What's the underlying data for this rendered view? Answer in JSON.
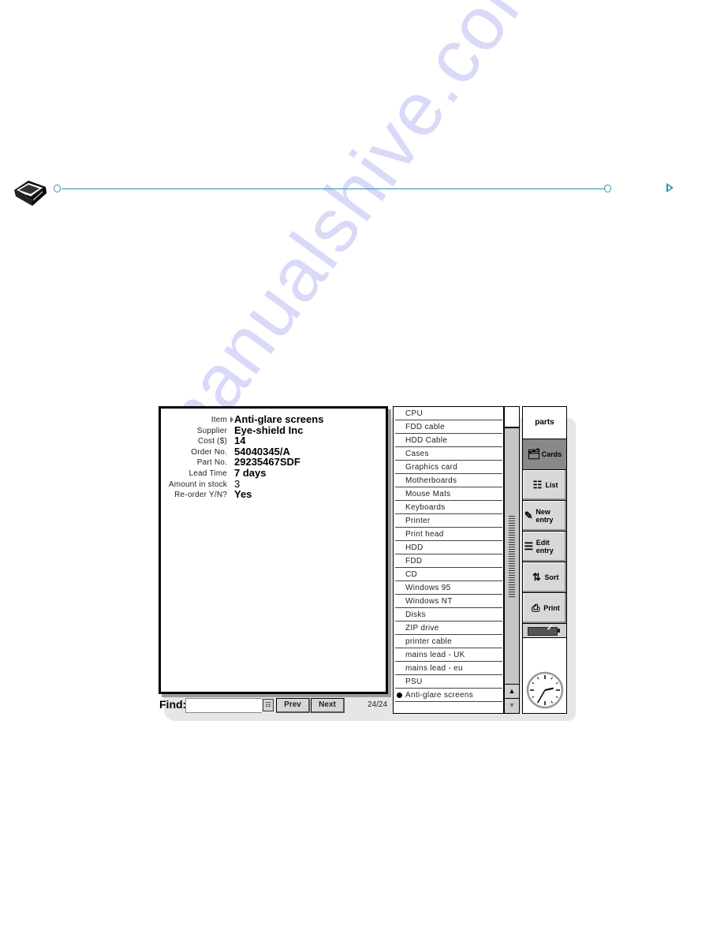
{
  "header": {
    "logo_icon": "psion-organiser-book-icon",
    "next_page_icon": "triangle-right-icon",
    "accent_color": "#2f8fb5"
  },
  "card": {
    "fields": [
      {
        "label": "Item",
        "value": "Anti-glare screens",
        "current": true
      },
      {
        "label": "Supplier",
        "value": "Eye-shield Inc"
      },
      {
        "label": "Cost ($)",
        "value": "14"
      },
      {
        "label": "Order No.",
        "value": "54040345/A"
      },
      {
        "label": "Part No.",
        "value": "29235467SDF"
      },
      {
        "label": "Lead Time",
        "value": "7 days"
      },
      {
        "label": "Amount in stock",
        "value": "3"
      },
      {
        "label": "Re-order Y/N?",
        "value": "Yes"
      }
    ]
  },
  "find_bar": {
    "label": "Find:",
    "input_value": "",
    "list_button_icon": "list-icon",
    "prev_label": "Prev",
    "next_label": "Next",
    "record_count": "24/24"
  },
  "list": {
    "items": [
      "CPU",
      "FDD cable",
      "HDD Cable",
      "Cases",
      "Graphics card",
      "Motherboards",
      "Mouse Mats",
      "Keyboards",
      "Printer",
      "Print head",
      "HDD",
      "FDD",
      "CD",
      "Windows 95",
      "Windows NT",
      "Disks",
      "ZIP drive",
      "printer cable",
      "mains lead - UK",
      "mains lead - eu",
      "PSU",
      "Anti-glare screens"
    ],
    "selected_index": 21,
    "scroll_up_icon": "▲",
    "scroll_down_icon": "▼"
  },
  "toolbar": {
    "title": "parts",
    "buttons": [
      {
        "label": "Cards",
        "icon": "cards-icon",
        "glyph": "🗂",
        "active": true
      },
      {
        "label": "List",
        "icon": "list-icon",
        "glyph": "☷"
      },
      {
        "label": "New entry",
        "icon": "new-entry-icon",
        "glyph": "✎"
      },
      {
        "label": "Edit entry",
        "icon": "edit-entry-icon",
        "glyph": "☰"
      },
      {
        "label": "Sort",
        "icon": "sort-icon",
        "glyph": "⇅"
      },
      {
        "label": "Print",
        "icon": "printer-icon",
        "glyph": "⎙"
      }
    ],
    "battery_status": "full",
    "clock_time": "2:35"
  },
  "watermark": "manualshive.com"
}
